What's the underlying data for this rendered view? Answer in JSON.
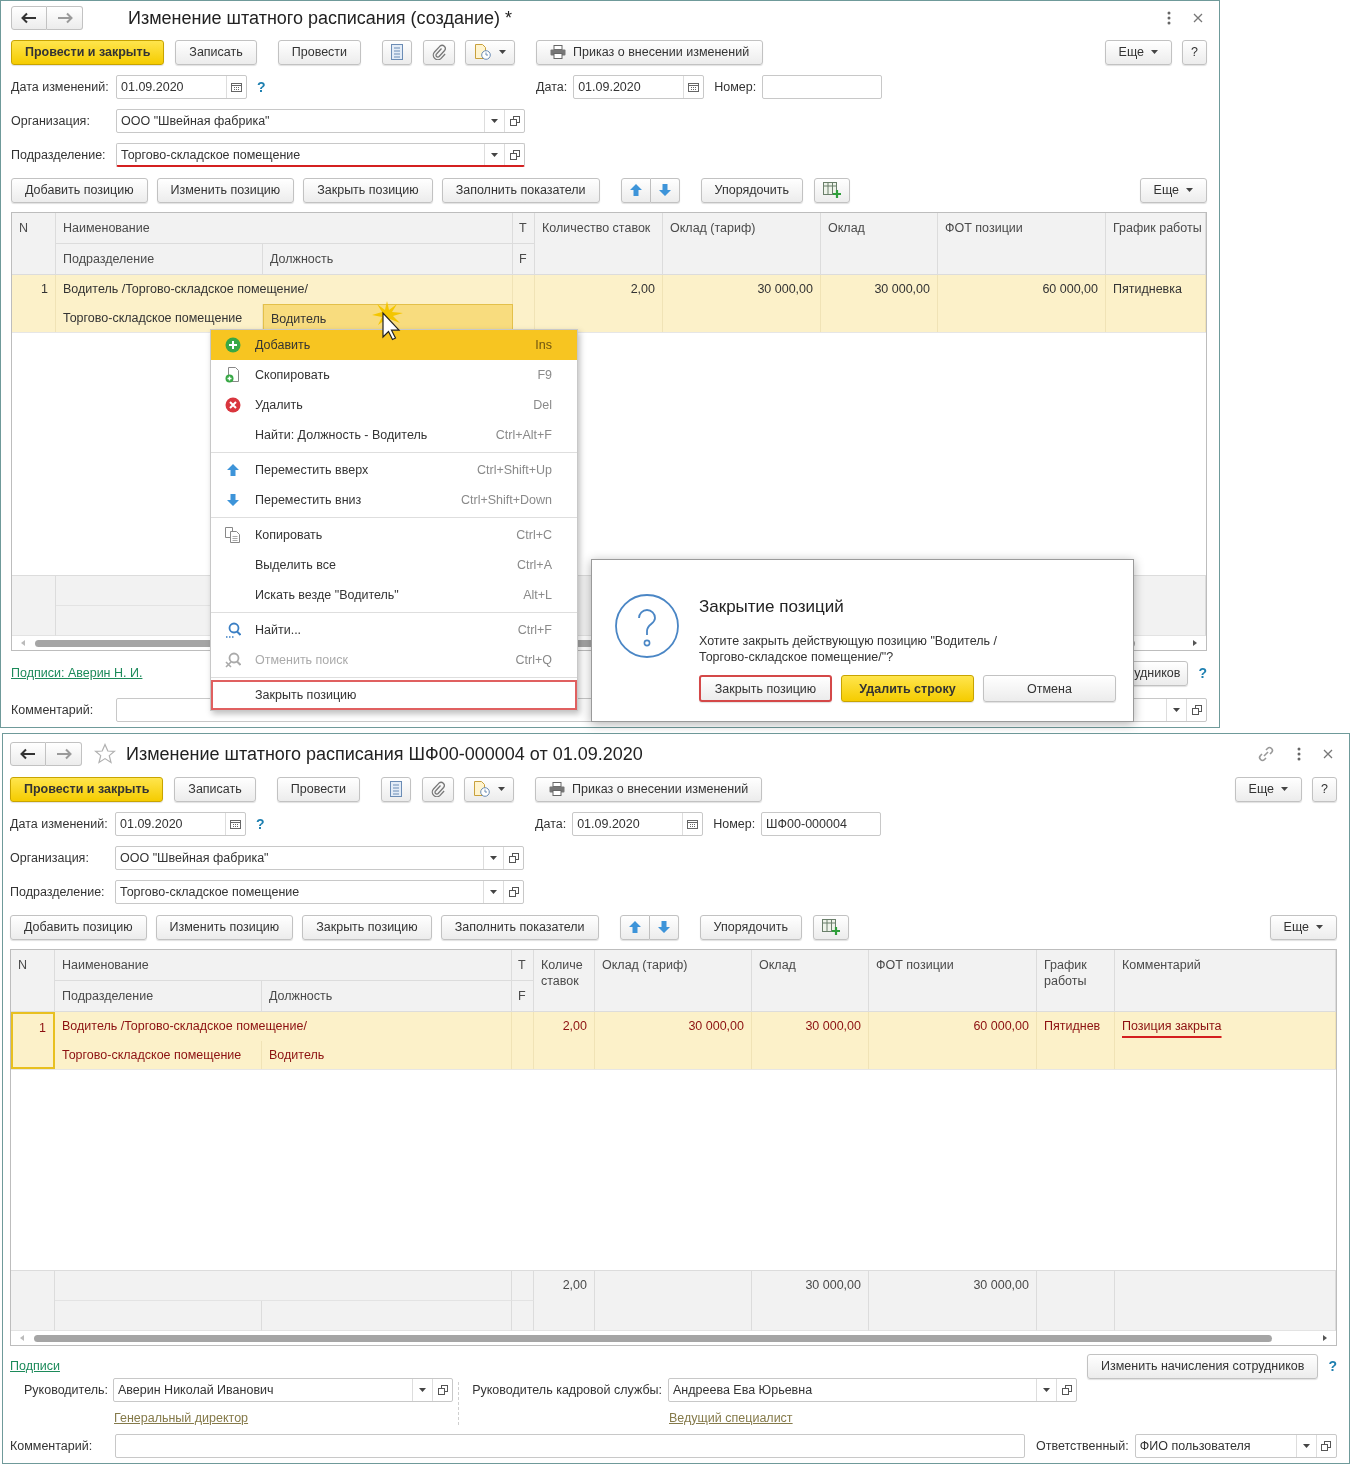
{
  "windows": [
    {
      "kind": "draft",
      "title": "Изменение штатного расписания (создание) *",
      "toolbar": {
        "post_close": "Провести и закрыть",
        "save": "Записать",
        "post": "Провести",
        "print": "Приказ о внесении изменений",
        "more": "Еще",
        "help": "?"
      },
      "header": {
        "change_date": {
          "label": "Дата изменений:",
          "value": "01.09.2020",
          "help": "?"
        },
        "date": {
          "label": "Дата:",
          "value": "01.09.2020"
        },
        "number": {
          "label": "Номер:"
        },
        "organization": {
          "label": "Организация:",
          "value": "ООО \"Швейная фабрика\""
        },
        "department": {
          "label": "Подразделение:",
          "value": "Торгово-складское помещение",
          "underlined": true
        }
      },
      "table_toolbar": {
        "buttons": [
          "Добавить позицию",
          "Изменить позицию",
          "Закрыть позицию",
          "Заполнить показатели"
        ],
        "sort": "Упорядочить",
        "more": "Еще"
      },
      "table": {
        "columns": {
          "n": "N",
          "name": "Наименование",
          "department": "Подразделение",
          "position": "Должность",
          "narrow": [
            "Т",
            "F"
          ],
          "values": [
            "Количество ставок",
            "Оклад (тариф)",
            "Оклад",
            "ФОТ позиции",
            "График работы"
          ]
        },
        "rows": [
          {
            "n": "1",
            "name": "Водитель /Торгово-складское помещение/",
            "department": "Торгово-складское помещение",
            "position": "Водитель",
            "values": [
              "2,00",
              "30 000,00",
              "30 000,00",
              "60 000,00",
              "Пятидневка"
            ],
            "selected": true,
            "closed": false,
            "focus_n": false,
            "focus_position": true
          }
        ]
      },
      "signatures": {
        "link": "Подписи: Аверин Н. И."
      },
      "accruals_button": "удников",
      "help": "?",
      "comment": {
        "label": "Комментарий:"
      },
      "context_menu": {
        "groups": [
          {
            "items": [
              {
                "label": "Добавить",
                "shortcut": "Ins",
                "selected": true,
                "disabled": false,
                "marked": false
              },
              {
                "label": "Скопировать",
                "shortcut": "F9",
                "selected": false,
                "disabled": false,
                "marked": false
              },
              {
                "label": "Удалить",
                "shortcut": "Del",
                "selected": false,
                "disabled": false,
                "marked": false
              },
              {
                "label": "Найти: Должность - Водитель",
                "shortcut": "Ctrl+Alt+F",
                "selected": false,
                "disabled": false,
                "marked": false
              }
            ]
          },
          {
            "items": [
              {
                "label": "Переместить вверх",
                "shortcut": "Ctrl+Shift+Up",
                "selected": false,
                "disabled": false,
                "marked": false
              },
              {
                "label": "Переместить вниз",
                "shortcut": "Ctrl+Shift+Down",
                "selected": false,
                "disabled": false,
                "marked": false
              }
            ]
          },
          {
            "items": [
              {
                "label": "Копировать",
                "shortcut": "Ctrl+C",
                "selected": false,
                "disabled": false,
                "marked": false
              },
              {
                "label": "Выделить все",
                "shortcut": "Ctrl+A",
                "selected": false,
                "disabled": false,
                "marked": false
              },
              {
                "label": "Искать везде \"Водитель\"",
                "shortcut": "Alt+L",
                "selected": false,
                "disabled": false,
                "marked": false
              }
            ]
          },
          {
            "items": [
              {
                "label": "Найти...",
                "shortcut": "Ctrl+F",
                "selected": false,
                "disabled": false,
                "marked": false
              },
              {
                "label": "Отменить поиск",
                "shortcut": "Ctrl+Q",
                "selected": false,
                "disabled": true,
                "marked": false
              }
            ]
          },
          {
            "items": [
              {
                "label": "Закрыть позицию",
                "selected": false,
                "disabled": false,
                "marked": true
              }
            ]
          }
        ]
      },
      "dialog": {
        "title": "Закрытие позиций",
        "message": "Хотите закрыть действующую позицию \"Водитель /Торгово-складское помещение/\"?",
        "buttons": [
          {
            "label": "Закрыть позицию",
            "marked": true,
            "default": false
          },
          {
            "label": "Удалить строку",
            "marked": false,
            "default": true
          },
          {
            "label": "Отмена",
            "marked": false,
            "default": false
          }
        ]
      }
    },
    {
      "kind": "posted",
      "title": "Изменение штатного расписания ШФ00-000004 от 01.09.2020",
      "toolbar": {
        "post_close": "Провести и закрыть",
        "save": "Записать",
        "post": "Провести",
        "print": "Приказ о внесении изменений",
        "more": "Еще",
        "help": "?"
      },
      "header": {
        "change_date": {
          "label": "Дата изменений:",
          "value": "01.09.2020",
          "help": "?"
        },
        "date": {
          "label": "Дата:",
          "value": "01.09.2020"
        },
        "number": {
          "label": "Номер:",
          "value": "ШФ00-000004"
        },
        "organization": {
          "label": "Организация:",
          "value": "ООО \"Швейная фабрика\""
        },
        "department": {
          "label": "Подразделение:",
          "value": "Торгово-складское помещение",
          "underlined": false
        }
      },
      "table_toolbar": {
        "buttons": [
          "Добавить позицию",
          "Изменить позицию",
          "Закрыть позицию",
          "Заполнить показатели"
        ],
        "sort": "Упорядочить",
        "more": "Еще"
      },
      "table": {
        "columns": {
          "n": "N",
          "name": "Наименование",
          "department": "Подразделение",
          "position": "Должность",
          "narrow": [
            "Т",
            "F"
          ],
          "values": [
            "Количе ставок",
            "Оклад (тариф)",
            "Оклад",
            "ФОТ позиции",
            "График работы",
            "Комментарий"
          ]
        },
        "rows": [
          {
            "n": "1",
            "name": "Водитель /Торгово-складское помещение/",
            "department": "Торгово-складское помещение",
            "position": "Водитель",
            "values": [
              "2,00",
              "30 000,00",
              "30 000,00",
              "60 000,00",
              "Пятиднев"
            ],
            "note": {
              "text": "Позиция закрыта",
              "underlined": true
            },
            "selected": true,
            "closed": true,
            "focus_n": true,
            "focus_position": false
          }
        ],
        "totals": {
          "rates": "2,00",
          "salary": "30 000,00",
          "payroll": "30 000,00"
        }
      },
      "signatures": {
        "link": "Подписи",
        "people": [
          {
            "label": "Руководитель:",
            "value": "Аверин Николай Иванович",
            "position": "Генеральный директор"
          },
          {
            "label": "Руководитель кадровой службы:",
            "value": "Андреева Ева Юрьевна",
            "position": "Ведущий специалист"
          }
        ]
      },
      "accruals_button": "Изменить начисления сотрудников",
      "help": "?",
      "comment": {
        "label": "Комментарий:"
      },
      "responsible": {
        "label": "Ответственный:",
        "value": "ФИО пользователя"
      }
    }
  ]
}
